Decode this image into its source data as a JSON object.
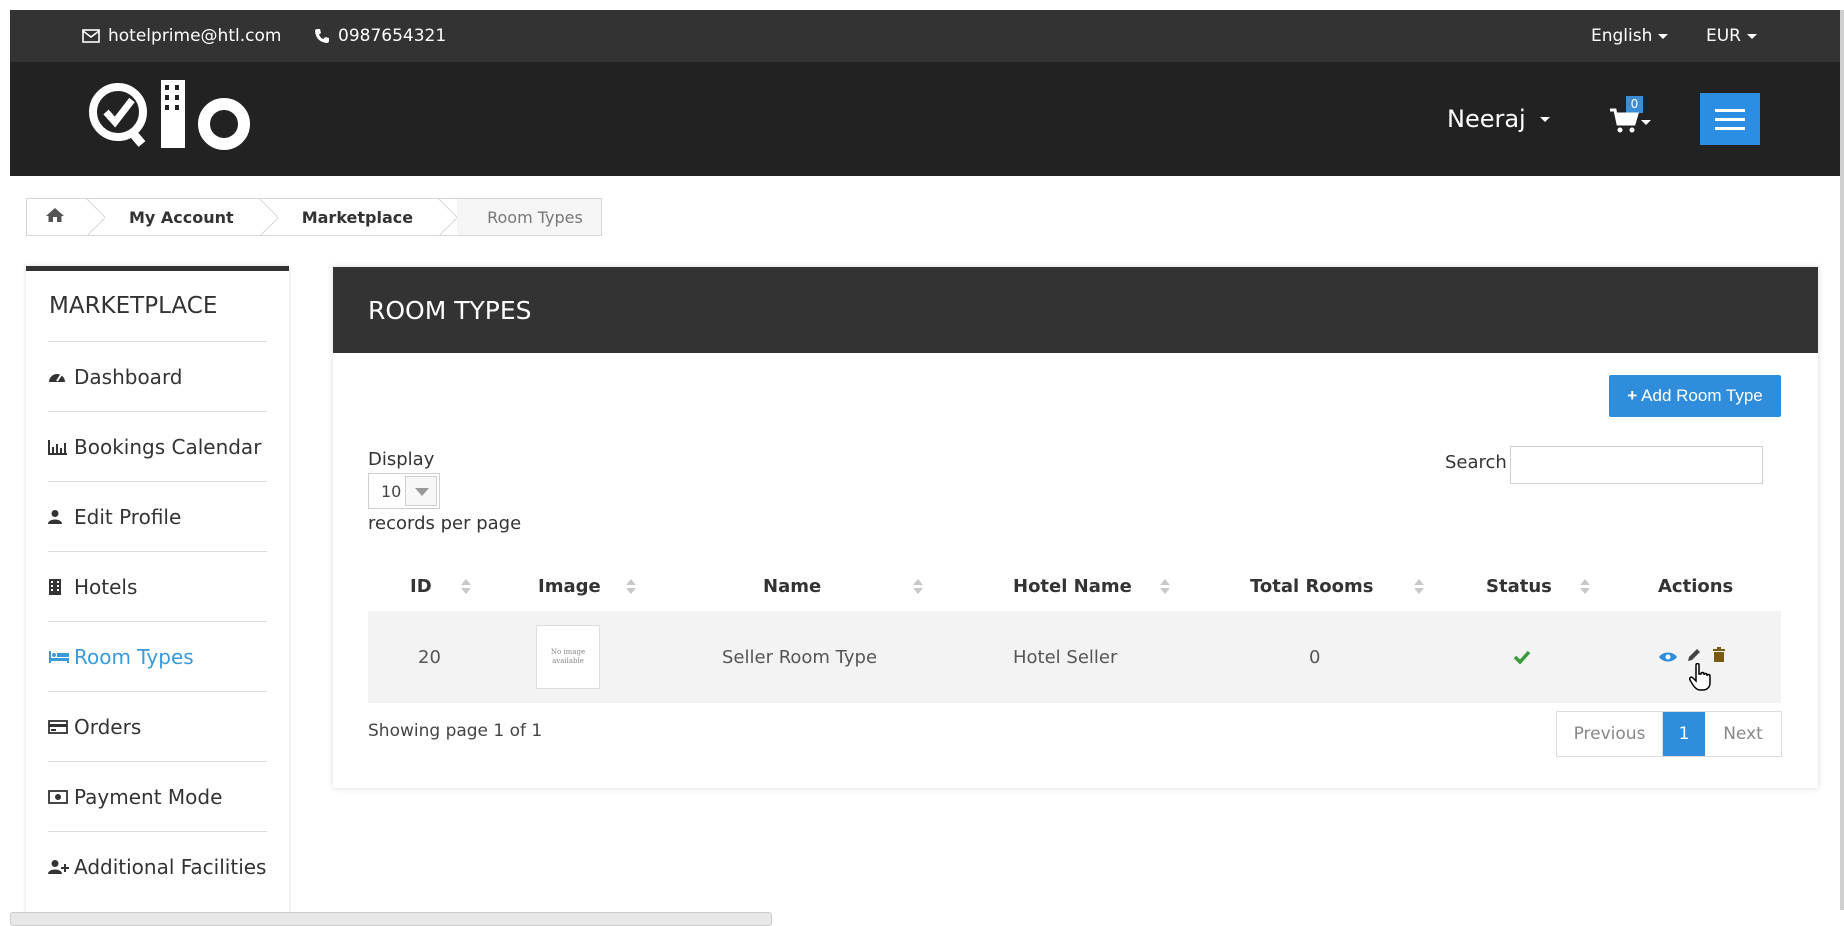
{
  "topbar": {
    "email": "hotelprime@htl.com",
    "phone": "0987654321",
    "language": "English",
    "currency": "EUR"
  },
  "header": {
    "user_name": "Neeraj",
    "cart_count": "0",
    "logo_icon": "qlo-logo",
    "menu_icon": "hamburger-icon"
  },
  "breadcrumb": {
    "home_icon": "home-icon",
    "items": [
      "My Account",
      "Marketplace",
      "Room Types"
    ]
  },
  "sidebar": {
    "title": "MARKETPLACE",
    "items": [
      {
        "label": "Dashboard",
        "icon": "dashboard-icon"
      },
      {
        "label": "Bookings Calendar",
        "icon": "bar-chart-icon"
      },
      {
        "label": "Edit Profile",
        "icon": "user-icon"
      },
      {
        "label": "Hotels",
        "icon": "building-icon"
      },
      {
        "label": "Room Types",
        "icon": "bed-icon"
      },
      {
        "label": "Orders",
        "icon": "credit-card-icon"
      },
      {
        "label": "Payment Mode",
        "icon": "money-icon"
      },
      {
        "label": "Additional Facilities",
        "icon": "user-plus-icon"
      }
    ],
    "active_item": "Room Types"
  },
  "main": {
    "title": "ROOM TYPES",
    "add_button": "Add Room Type",
    "display_label": "Display",
    "display_value": "10",
    "records_label": "records per page",
    "search_label": "Search",
    "search_value": "",
    "columns": [
      "ID",
      "Image",
      "Name",
      "Hotel Name",
      "Total Rooms",
      "Status",
      "Actions"
    ],
    "rows": [
      {
        "id": "20",
        "image_text": "No image available",
        "name": "Seller Room Type",
        "hotel_name": "Hotel Seller",
        "total_rooms": "0",
        "status_icon": "check-icon",
        "actions": [
          "view-icon",
          "edit-icon",
          "delete-icon"
        ]
      }
    ],
    "showing": "Showing page 1 of 1",
    "pagination": {
      "previous": "Previous",
      "current": "1",
      "next": "Next"
    }
  },
  "colors": {
    "header_bg": "#222222",
    "topbar_bg": "#333333",
    "accent": "#2f8ddb",
    "active_link": "#3a9ad9",
    "status_ok": "#3a9a3a"
  }
}
